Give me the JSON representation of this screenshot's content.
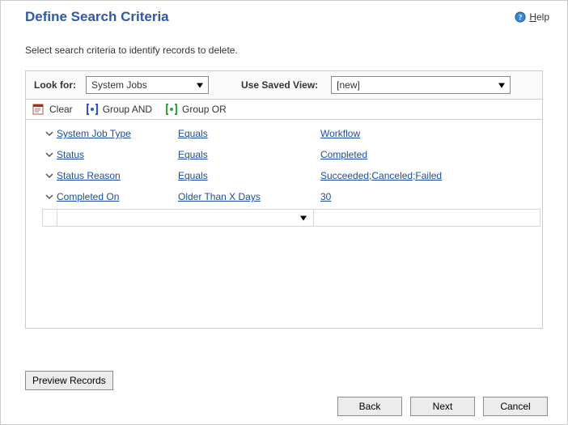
{
  "header": {
    "title": "Define Search Criteria",
    "help_label": "Help"
  },
  "instruction": "Select search criteria to identify records to delete.",
  "lookfor": {
    "label": "Look for:",
    "value": "System Jobs",
    "savedview_label": "Use Saved View:",
    "savedview_value": "[new]"
  },
  "toolbar": {
    "clear": "Clear",
    "group_and": "Group AND",
    "group_or": "Group OR"
  },
  "criteria": [
    {
      "field": "System Job Type",
      "operator": "Equals",
      "value": "Workflow"
    },
    {
      "field": "Status",
      "operator": "Equals",
      "value": "Completed"
    },
    {
      "field": "Status Reason",
      "operator": "Equals",
      "value": "Succeeded;Canceled;Failed"
    },
    {
      "field": "Completed On",
      "operator": "Older Than X Days",
      "value": "30"
    }
  ],
  "buttons": {
    "preview": "Preview Records",
    "back": "Back",
    "next": "Next",
    "cancel": "Cancel"
  }
}
